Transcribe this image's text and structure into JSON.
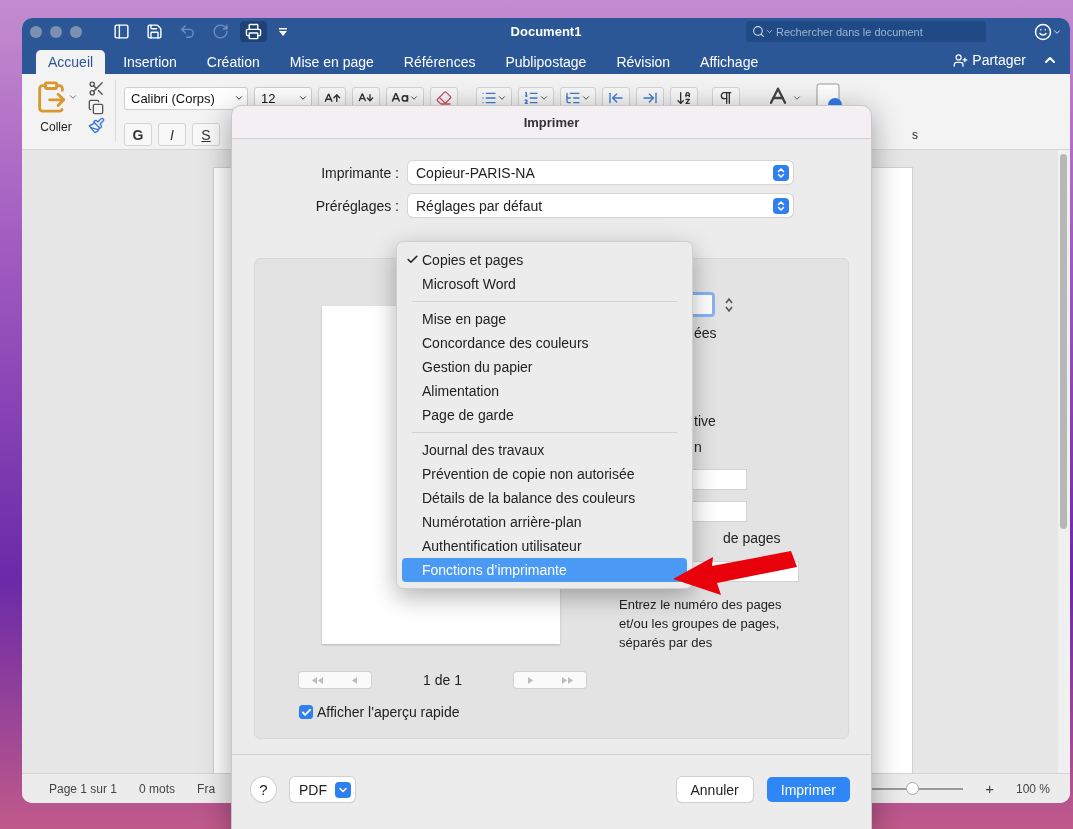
{
  "window": {
    "title": "Document1"
  },
  "quick_access": [
    {
      "kind": "sidebar",
      "disabled": false,
      "highlighted": false
    },
    {
      "kind": "save",
      "disabled": false,
      "highlighted": false
    },
    {
      "kind": "undo",
      "disabled": true,
      "highlighted": false
    },
    {
      "kind": "redo",
      "disabled": true,
      "highlighted": false
    },
    {
      "kind": "print",
      "disabled": false,
      "highlighted": true
    },
    {
      "kind": "customize",
      "disabled": false,
      "highlighted": false
    }
  ],
  "search": {
    "placeholder": "Rechercher dans le document"
  },
  "tabs": [
    {
      "label": "Accueil",
      "selected": true
    },
    {
      "label": "Insertion",
      "selected": false
    },
    {
      "label": "Création",
      "selected": false
    },
    {
      "label": "Mise en page",
      "selected": false
    },
    {
      "label": "Références",
      "selected": false
    },
    {
      "label": "Publipostage",
      "selected": false
    },
    {
      "label": "Révision",
      "selected": false
    },
    {
      "label": "Affichage",
      "selected": false
    }
  ],
  "share_button": {
    "label": "Partager"
  },
  "ribbon": {
    "paste_label": "Coller",
    "font": "Calibri (Corps)",
    "size": "12",
    "format_buttons": [
      "G",
      "I",
      "S"
    ],
    "cut_label": "s"
  },
  "status_bar": {
    "page": "Page 1 sur 1",
    "words": "0 mots",
    "language": "Fra",
    "zoom_slider": {
      "level": 0.53
    },
    "zoom_in": "+",
    "zoom": "100 %"
  },
  "dialog": {
    "title": "Imprimer",
    "fields": [
      {
        "label": "Imprimante :",
        "value": "Copieur-PARIS-NA"
      },
      {
        "label": "Préréglages :",
        "value": "Réglages par défaut"
      }
    ],
    "menu": {
      "sections": [
        {
          "items": [
            {
              "label": "Copies et pages",
              "checked": true,
              "selected": false
            },
            {
              "label": "Microsoft Word",
              "checked": false,
              "selected": false
            }
          ]
        },
        {
          "items": [
            {
              "label": "Mise en page",
              "checked": false,
              "selected": false
            },
            {
              "label": "Concordance des couleurs",
              "checked": false,
              "selected": false
            },
            {
              "label": "Gestion du papier",
              "checked": false,
              "selected": false
            },
            {
              "label": "Alimentation",
              "checked": false,
              "selected": false
            },
            {
              "label": "Page de garde",
              "checked": false,
              "selected": false
            }
          ]
        },
        {
          "items": [
            {
              "label": "Journal des travaux",
              "checked": false,
              "selected": false
            },
            {
              "label": "Prévention de copie non autorisée",
              "checked": false,
              "selected": false
            },
            {
              "label": "Détails de la balance des couleurs",
              "checked": false,
              "selected": false
            },
            {
              "label": "Numérotation arrière-plan",
              "checked": false,
              "selected": false
            },
            {
              "label": "Authentification utilisateur",
              "checked": false,
              "selected": false
            },
            {
              "label": "Fonctions d’imprimante",
              "checked": false,
              "selected": true
            }
          ]
        }
      ]
    },
    "partial_labels": [
      "ées",
      "tive",
      "n",
      "de pages"
    ],
    "range_hint": "Entrez le numéro des pages et/ou les groupes de pages, séparés par des",
    "page_counter": "1 de 1",
    "quick_preview": {
      "label": "Afficher l'aperçu rapide",
      "checked": true
    },
    "help": "?",
    "pdf_button": "PDF",
    "buttons": [
      {
        "label": "Annuler",
        "kind": "default"
      },
      {
        "label": "Imprimer",
        "kind": "primary"
      }
    ]
  }
}
